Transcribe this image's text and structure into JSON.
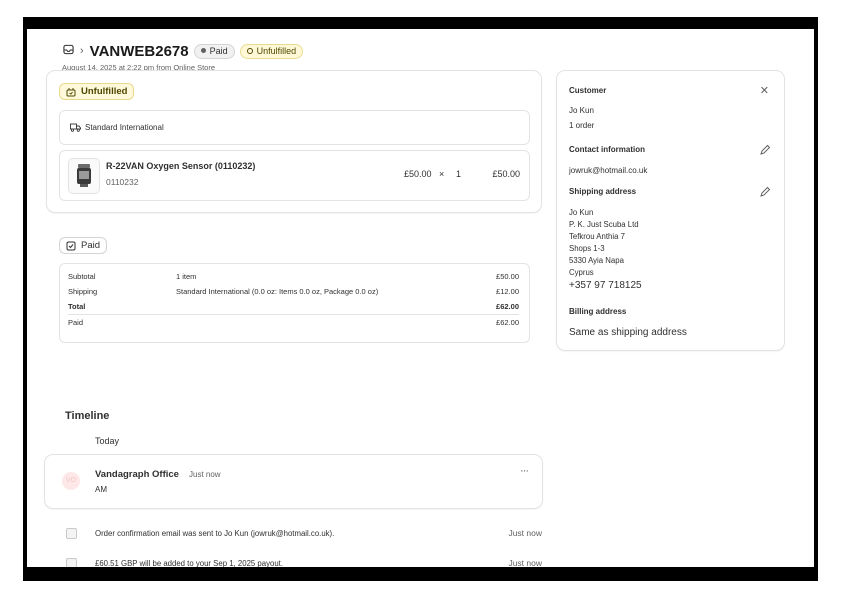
{
  "header": {
    "order_name": "VANWEB2678",
    "paid_badge": "Paid",
    "fulfillment_badge": "Unfulfilled",
    "subtitle": "August 14, 2025 at 2:22 pm from Online Store"
  },
  "fulfillment_card": {
    "status_badge": "Unfulfilled",
    "shipping_method": "Standard International",
    "line_item": {
      "title": "R-22VAN Oxygen Sensor (0110232)",
      "sku": "0110232",
      "unit_price": "£50.00",
      "times": "×",
      "quantity": "1",
      "total": "£50.00"
    }
  },
  "payment_card": {
    "status_badge": "Paid",
    "rows": [
      {
        "label": "Subtotal",
        "detail": "1 item",
        "amount": "£50.00"
      },
      {
        "label": "Shipping",
        "detail": "Standard International (0.0 oz: Items 0.0 oz, Package 0.0 oz)",
        "amount": "£12.00"
      },
      {
        "label": "Total",
        "detail": "",
        "amount": "£62.00"
      },
      {
        "label": "Paid",
        "detail": "",
        "amount": "£62.00"
      }
    ]
  },
  "customer_card": {
    "title": "Customer",
    "name": "Jo Kun",
    "orders": "1 order",
    "contact_title": "Contact information",
    "email": "jowruk@hotmail.co.uk",
    "shipping_title": "Shipping address",
    "address_lines": [
      "Jo Kun",
      "P. K. Just Scuba Ltd",
      "Tefkrou Anthia 7",
      "Shops 1-3",
      "5330 Ayia Napa",
      "Cyprus"
    ],
    "phone": "+357 97 718125",
    "billing_title": "Billing address",
    "billing_value": "Same as shipping address"
  },
  "timeline": {
    "title": "Timeline",
    "day_label": "Today",
    "comment": {
      "avatar_initials": "VO",
      "author": "Vandagraph Office",
      "time": "Just now",
      "body": "AM",
      "menu": "···"
    },
    "events": [
      {
        "text": "Order confirmation email was sent to Jo Kun (jowruk@hotmail.co.uk).",
        "time": "Just now"
      },
      {
        "text": "£60.51 GBP will be added to your Sep 1, 2025 payout.",
        "time": "Just now"
      }
    ]
  },
  "colors": {
    "unfulfilled_bg": "#fff9db",
    "unfulfilled_text": "#4f4700",
    "border": "#e3e3e3",
    "text": "#303030",
    "muted": "#616161"
  }
}
